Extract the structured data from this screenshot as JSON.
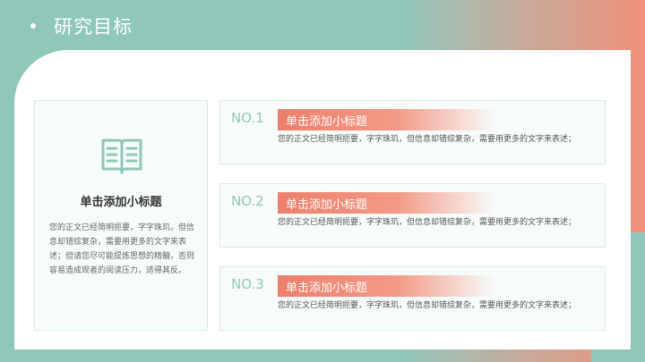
{
  "header": {
    "title": "研究目标"
  },
  "left_card": {
    "icon": "open-book-icon",
    "title": "单击添加小标题",
    "body": "您的正文已经简明扼要，字字珠玑，但信息却错综复杂，需要用更多的文字来表述；但请您尽可能提炼思想的精髓，否则容易造成观者的阅读压力，适得其反。"
  },
  "items": [
    {
      "number": "NO.1",
      "title": "单击添加小标题",
      "desc": "您的正文已经简明扼要，字字珠玑，但信息却错综复杂，需要用更多的文字来表述；"
    },
    {
      "number": "NO.2",
      "title": "单击添加小标题",
      "desc": "您的正文已经简明扼要，字字珠玑，但信息却错综复杂，需要用更多的文字来表述；"
    },
    {
      "number": "NO.3",
      "title": "单击添加小标题",
      "desc": "您的正文已经简明扼要，字字珠玑，但信息却错综复杂，需要用更多的文字来表述；"
    }
  ],
  "colors": {
    "teal": "#8fc7bb",
    "coral": "#ec7f6b"
  }
}
